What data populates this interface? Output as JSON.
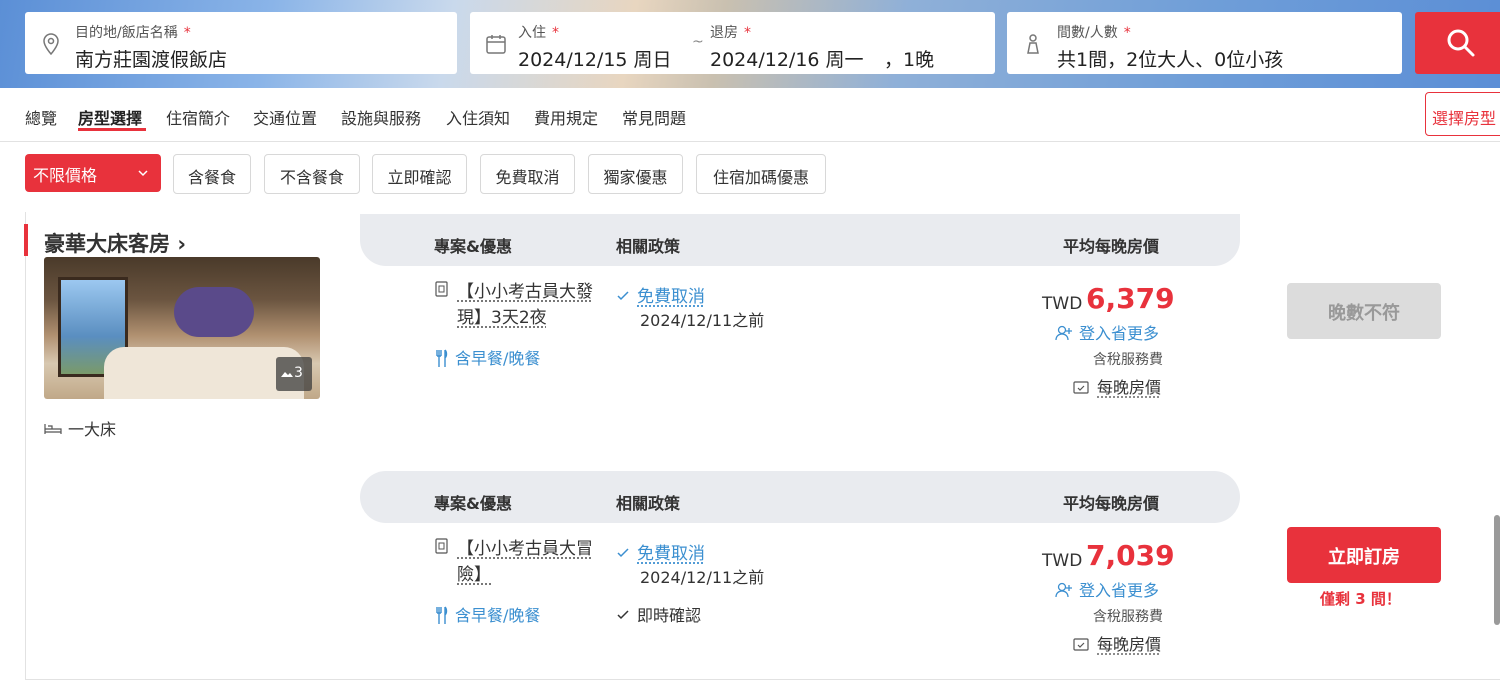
{
  "search": {
    "destination_label": "目的地/飯店名稱",
    "destination_value": "南方莊園渡假飯店",
    "checkin_label": "入住",
    "checkin_value": "2024/12/15 周日",
    "tilde": "~",
    "checkout_label": "退房",
    "checkout_value": "2024/12/16 周一",
    "nights": "，1晚",
    "guests_label": "間數/人數",
    "guests_value": "共1間，2位大人、0位小孩",
    "required_mark": "*"
  },
  "nav": {
    "items": [
      "總覽",
      "房型選擇",
      "住宿簡介",
      "交通位置",
      "設施與服務",
      "入住須知",
      "費用規定",
      "常見問題"
    ],
    "choose_room": "選擇房型"
  },
  "filters": {
    "price_select": "不限價格",
    "chips": [
      "含餐食",
      "不含餐食",
      "立即確認",
      "免費取消",
      "獨家優惠",
      "住宿加碼優惠"
    ]
  },
  "room": {
    "name": "豪華大床客房",
    "chevron": "›",
    "photo_count": "3",
    "bed": "一大床"
  },
  "table_headers": {
    "plan": "專案&優惠",
    "policy": "相關政策",
    "price": "平均每晚房價"
  },
  "plans": [
    {
      "title_line1": "【小小考古員大發",
      "title_line2": "現】3天2夜",
      "meal": "含早餐/晚餐",
      "cancel": "免費取消",
      "cancel_date": "2024/12/11之前",
      "currency": "TWD",
      "price": "6,379",
      "login": "登入省更多",
      "tax": "含稅服務費",
      "nightly": "每晚房價",
      "button": "晚數不符"
    },
    {
      "title_line1": "【小小考古員大冒",
      "title_line2": "險】",
      "meal": "含早餐/晚餐",
      "cancel": "免費取消",
      "cancel_date": "2024/12/11之前",
      "instant": "即時確認",
      "currency": "TWD",
      "price": "7,039",
      "login": "登入省更多",
      "tax": "含稅服務費",
      "nightly": "每晚房價",
      "button": "立即訂房",
      "remaining": "僅剩 3 間！"
    }
  ],
  "colors": {
    "accent": "#e8323c",
    "link": "#3b8fd0"
  }
}
